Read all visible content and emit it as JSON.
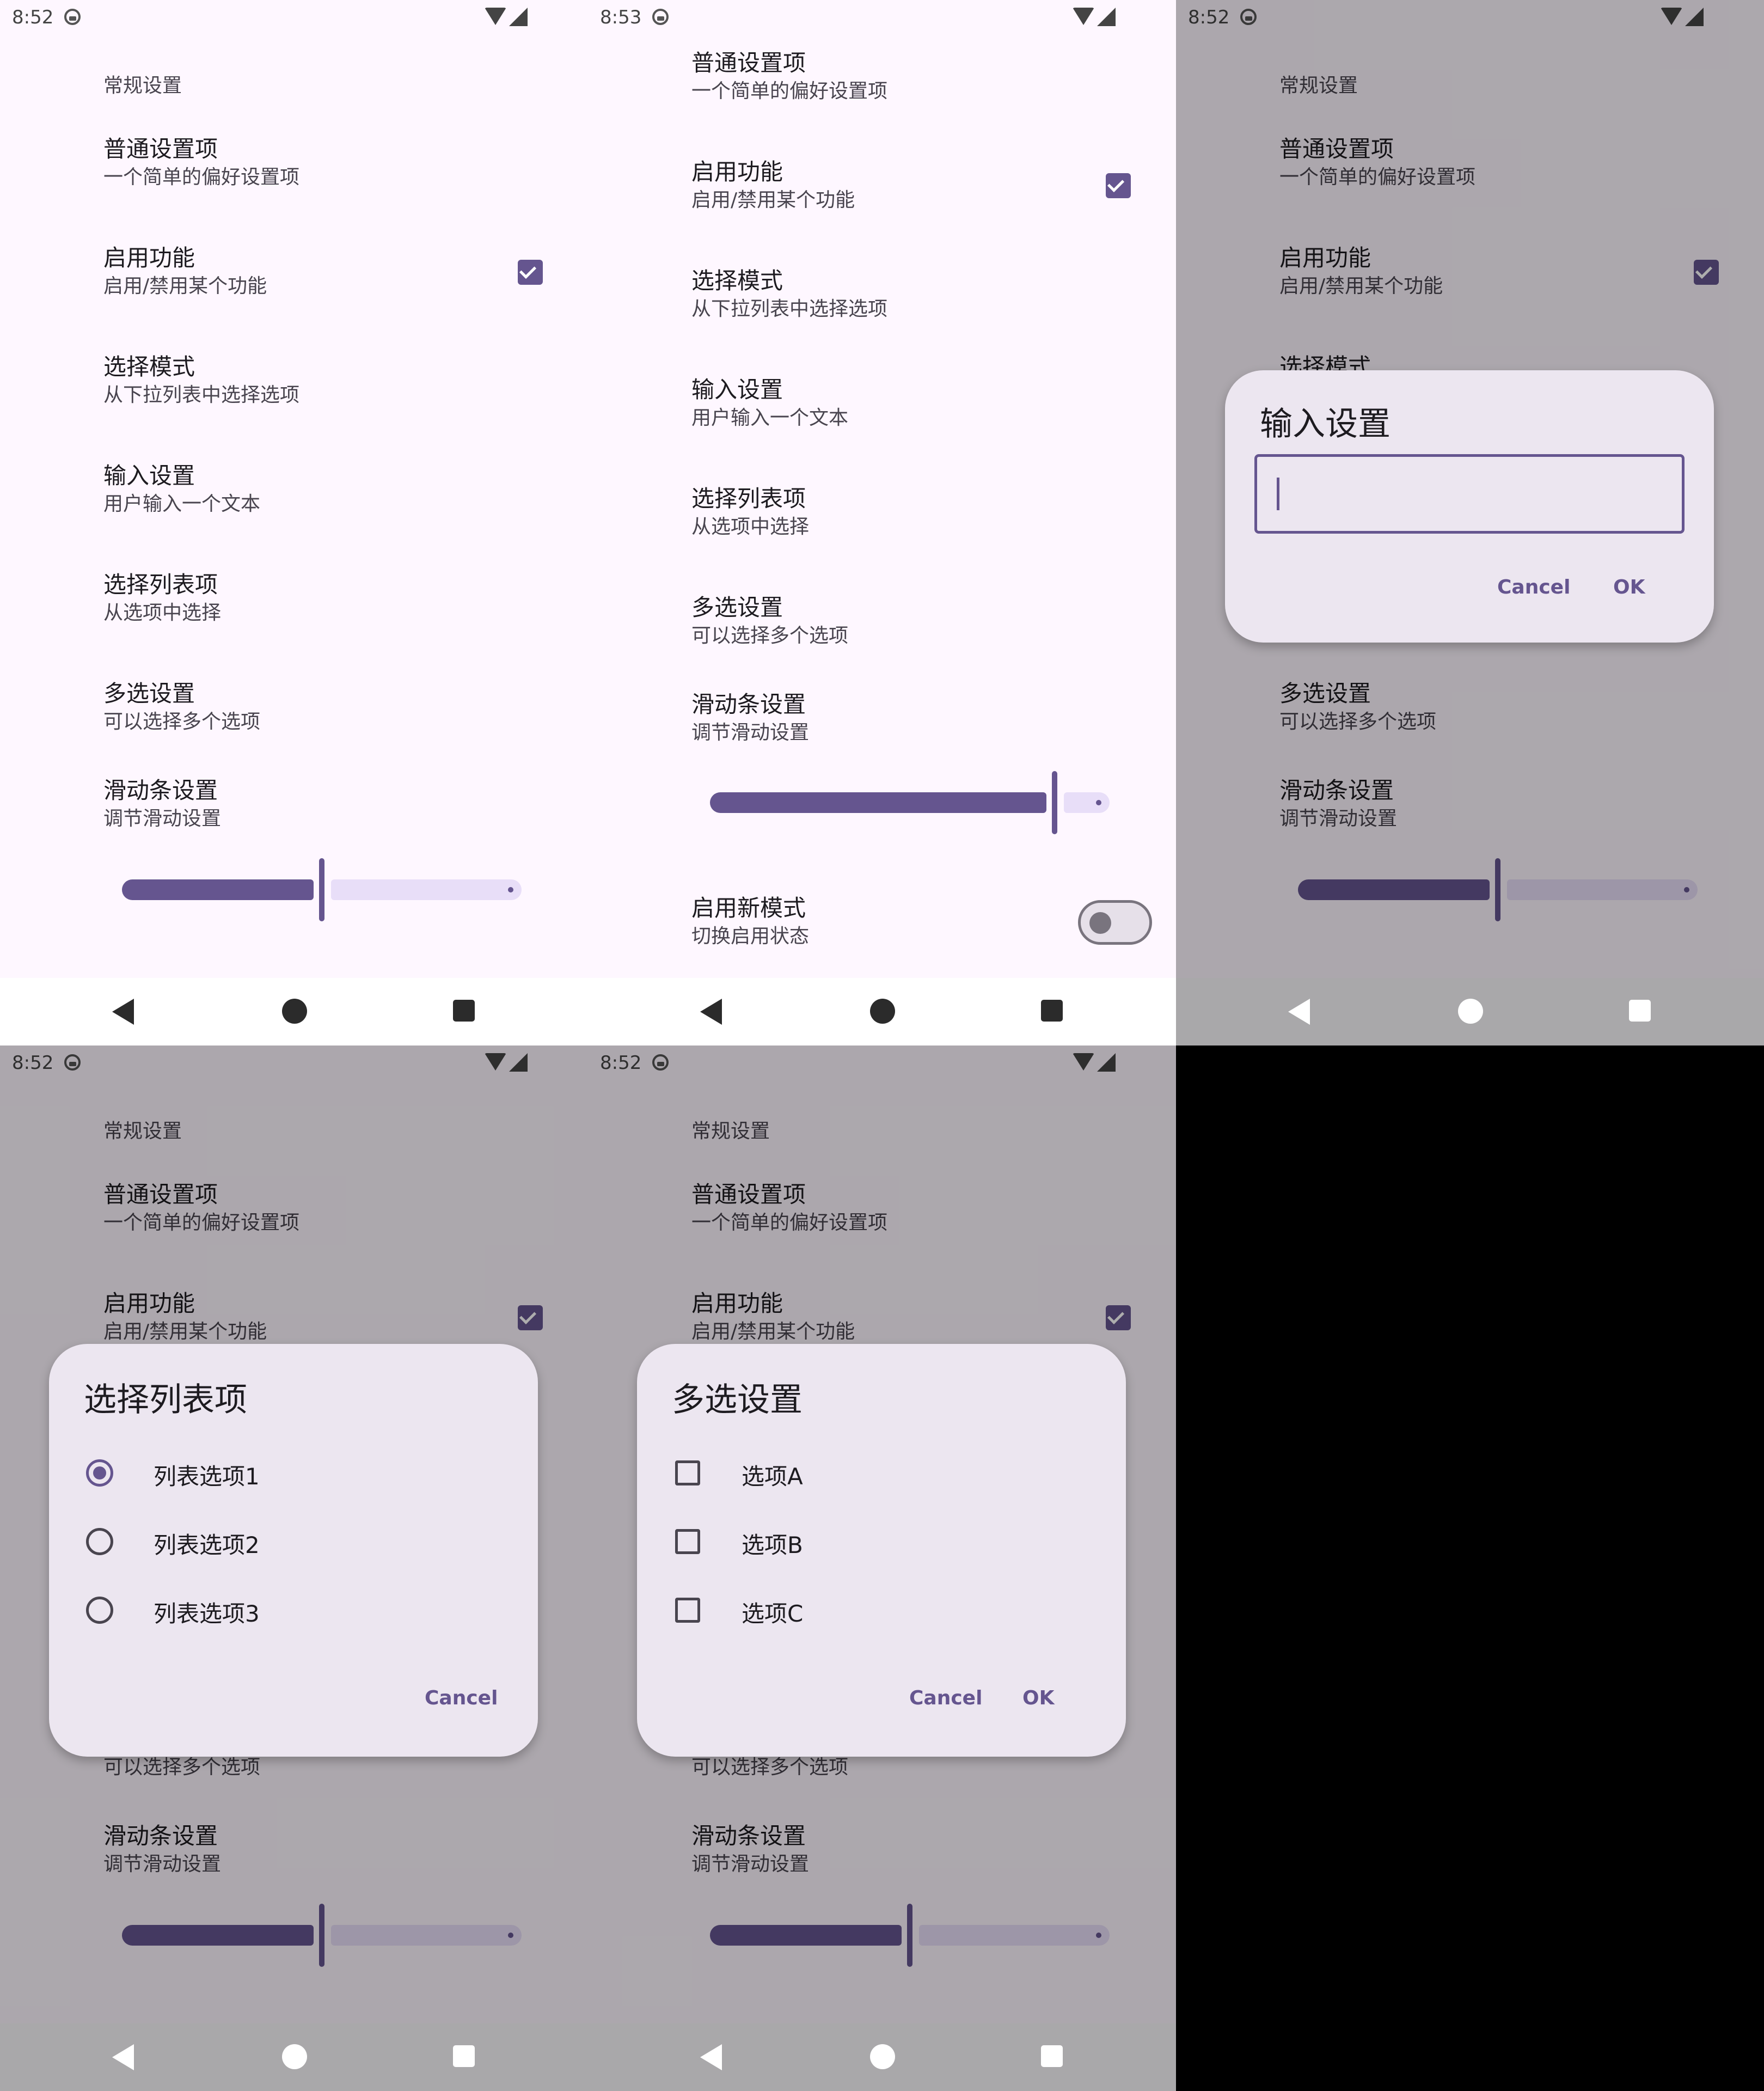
{
  "screens": {
    "s1": {
      "time": "8:52"
    },
    "s2": {
      "time": "8:53"
    },
    "s3": {
      "time": "8:52"
    },
    "s4": {
      "time": "8:52"
    },
    "s5": {
      "time": "8:52"
    }
  },
  "settings": {
    "category": "常规设置",
    "general": {
      "title": "普通设置项",
      "summary": "一个简单的偏好设置项"
    },
    "enable": {
      "title": "启用功能",
      "summary": "启用/禁用某个功能",
      "checked": true
    },
    "select_mode": {
      "title": "选择模式",
      "summary": "从下拉列表中选择选项"
    },
    "input": {
      "title": "输入设置",
      "summary": "用户输入一个文本"
    },
    "list": {
      "title": "选择列表项",
      "summary": "从选项中选择"
    },
    "multi": {
      "title": "多选设置",
      "summary": "可以选择多个选项"
    },
    "slider": {
      "title": "滑动条设置",
      "summary": "调节滑动设置",
      "value_fraction_s1": 0.49,
      "value_fraction_s2": 0.74,
      "value_fraction_s5": 0.49
    },
    "new_mode": {
      "title": "启用新模式",
      "summary": "切换启用状态",
      "on": false
    }
  },
  "dialog_input": {
    "title": "输入设置",
    "value": "",
    "cancel": "Cancel",
    "ok": "OK"
  },
  "dialog_list": {
    "title": "选择列表项",
    "options": [
      "列表选项1",
      "列表选项2",
      "列表选项3"
    ],
    "selected_index": 0,
    "cancel": "Cancel"
  },
  "dialog_multi": {
    "title": "多选设置",
    "options": [
      "选项A",
      "选项B",
      "选项C"
    ],
    "checked": [
      false,
      false,
      false
    ],
    "cancel": "Cancel",
    "ok": "OK"
  },
  "colors": {
    "accent": "#65558f",
    "background": "#fef7ff",
    "dialog": "#ece6f0"
  }
}
